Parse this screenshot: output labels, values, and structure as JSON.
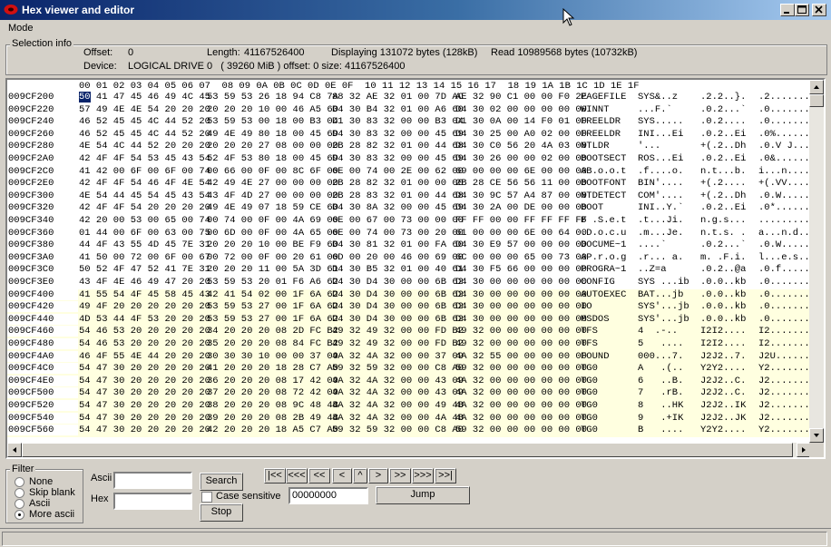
{
  "window": {
    "title": "Hex viewer and editor"
  },
  "menu": {
    "items": [
      "Mode"
    ]
  },
  "selection_info": {
    "legend": "Selection info",
    "offset_label": "Offset:",
    "offset_value": "0",
    "length_label": "Length:",
    "length_value": "41167526400",
    "displaying": "Displaying 131072 bytes (128kB)",
    "read": "Read 10989568 bytes (10732kB)",
    "device_label": "Device:",
    "device_value": "LOGICAL DRIVE 0   ( 39260 MiB ) offset: 0 size: 41167526400"
  },
  "hex_header": "00 01 02 03 04 05 06 07  08 09 0A 0B 0C 0D 0E 0F  10 11 12 13 14 15 16 17  18 19 1A 1B 1C 1D 1E 1F",
  "selected_byte": "50",
  "rows": [
    {
      "off": "009CF200",
      "h1": "50 41 47 45 46 49 4C 45",
      "h2": "53 59 53 26 18 94 C8 7A",
      "h3": "88 32 AE 32 01 00 7D AC",
      "h4": "AE 32 90 C1 00 00 F0 2E",
      "a1": "PAGEFILE",
      "a2": "SYS&..z",
      "a3": ".2.2..}.",
      "a4": ".2........",
      "hl": false
    },
    {
      "off": "009CF220",
      "h1": "57 49 4E 4E 54 20 20 20",
      "h2": "20 20 20 10 00 46 A5 60",
      "h3": "D4 30 B4 32 01 00 A6 60",
      "h4": "D4 30 02 00 00 00 00 00",
      "a1": "WINNT",
      "a2": "...F.`",
      "a3": ".0.2...`",
      "a4": ".0........",
      "hl": false
    },
    {
      "off": "009CF240",
      "h1": "46 52 45 45 4C 44 52 20",
      "h2": "53 59 53 00 18 00 B3 04",
      "h3": "D1 30 83 32 00 00 B3 04",
      "h4": "D1 30 0A 00 14 F0 01 00",
      "a1": "FREELDR",
      "a2": "SYS.....",
      "a3": ".0.2....",
      "a4": ".0........",
      "hl": false
    },
    {
      "off": "009CF260",
      "h1": "46 52 45 45 4C 44 52 20",
      "h2": "49 4E 49 80 18 00 45 69",
      "h3": "D4 30 83 32 00 00 45 69",
      "h4": "D4 30 25 00 A0 02 00 00",
      "a1": "FREELDR",
      "a2": "INI...Ei",
      "a3": ".0.2..Ei",
      "a4": ".0%.......",
      "hl": false
    },
    {
      "off": "009CF280",
      "h1": "4E 54 4C 44 52 20 20 20",
      "h2": "20 20 20 27 08 00 00 00",
      "h3": "2B 28 82 32 01 00 44 68",
      "h4": "D4 30 C0 56 20 4A 03 00",
      "a1": "NTLDR",
      "a2": "'...",
      "a3": "+(.2..Dh",
      "a4": ".0.V J....",
      "hl": false
    },
    {
      "off": "009CF2A0",
      "h1": "42 4F 4F 54 53 45 43 54",
      "h2": "52 4F 53 80 18 00 45 69",
      "h3": "D4 30 83 32 00 00 45 69",
      "h4": "D4 30 26 00 00 02 00 00",
      "a1": "BOOTSECT",
      "a2": "ROS...Ei",
      "a3": ".0.2..Ei",
      "a4": ".0&.......",
      "hl": false
    },
    {
      "off": "009CF2C0",
      "h1": "41 42 00 6F 00 6F 00 74",
      "h2": "00 66 00 0F 00 8C 6F 00",
      "h3": "6E 00 74 00 2E 00 62 00",
      "h4": "69 00 00 00 6E 00 00 00",
      "a1": "AB.o.o.t",
      "a2": ".f....o.",
      "a3": "n.t...b.",
      "a4": "i...n.....",
      "hl": false
    },
    {
      "off": "009CF2E0",
      "h1": "42 4F 4F 54 46 4F 4E 54",
      "h2": "42 49 4E 27 00 00 00 00",
      "h3": "2B 28 82 32 01 00 00 00",
      "h4": "2B 28 CE 56 56 11 00 00",
      "a1": "BOOTFONT",
      "a2": "BIN'....",
      "a3": "+(.2....",
      "a4": "+(.VV.....",
      "hl": false
    },
    {
      "off": "009CF300",
      "h1": "4E 54 44 45 54 45 43 54",
      "h2": "43 4F 4D 27 00 00 00 00",
      "h3": "2B 28 83 32 01 00 44 68",
      "h4": "D4 30 9C 57 A4 87 00 00",
      "a1": "NTDETECT",
      "a2": "COM'....",
      "a3": "+(.2..Dh",
      "a4": ".0.W......",
      "hl": false
    },
    {
      "off": "009CF320",
      "h1": "42 4F 4F 54 20 20 20 20",
      "h2": "49 4E 49 07 18 59 CE 60",
      "h3": "D4 30 8A 32 00 00 45 69",
      "h4": "D4 30 2A 00 DE 00 00 00",
      "a1": "BOOT",
      "a2": "INI..Y.`",
      "a3": ".0.2..Ei",
      "a4": ".0*.......",
      "hl": false
    },
    {
      "off": "009CF340",
      "h1": "42 20 00 53 00 65 00 74",
      "h2": "00 74 00 0F 00 4A 69 00",
      "h3": "6E 00 67 00 73 00 00 00",
      "h4": "FF FF 00 00 FF FF FF FF",
      "a1": "B .S.e.t",
      "a2": ".t...Ji.",
      "a3": "n.g.s...",
      "a4": "..........",
      "hl": false
    },
    {
      "off": "009CF360",
      "h1": "01 44 00 6F 00 63 00 75",
      "h2": "00 6D 00 0F 00 4A 65 00",
      "h3": "6E 00 74 00 73 00 20 00",
      "h4": "61 00 00 00 6E 00 64 00",
      "a1": ".D.o.c.u",
      "a2": ".m...Je.",
      "a3": "n.t.s. .",
      "a4": "a...n.d...",
      "hl": false
    },
    {
      "off": "009CF380",
      "h1": "44 4F 43 55 4D 45 7E 31",
      "h2": "20 20 20 10 00 BE F9 60",
      "h3": "D4 30 81 32 01 00 FA 60",
      "h4": "D4 30 E9 57 00 00 00 00",
      "a1": "DOCUME~1",
      "a2": "....`",
      "a3": ".0.2...`",
      "a4": ".0.W......",
      "hl": false
    },
    {
      "off": "009CF3A0",
      "h1": "41 50 00 72 00 6F 00 67",
      "h2": "00 72 00 0F 00 20 61 00",
      "h3": "6D 00 20 00 46 00 69 00",
      "h4": "6C 00 00 00 65 00 73 00",
      "a1": "AP.r.o.g",
      "a2": ".r... a.",
      "a3": "m. .F.i.",
      "a4": "l...e.s...",
      "hl": false
    },
    {
      "off": "009CF3C0",
      "h1": "50 52 4F 47 52 41 7E 31",
      "h2": "20 20 20 11 00 5A 3D 61",
      "h3": "D4 30 B5 32 01 00 40 61",
      "h4": "D4 30 F5 66 00 00 00 00",
      "a1": "PROGRA~1",
      "a2": "..Z=a",
      "a3": ".0.2..@a",
      "a4": ".0.f......",
      "hl": false
    },
    {
      "off": "009CF3E0",
      "h1": "43 4F 4E 46 49 47 20 20",
      "h2": "53 59 53 20 01 F6 A6 62",
      "h3": "D4 30 D4 30 00 00 6B 62",
      "h4": "D4 30 00 00 00 00 00 00",
      "a1": "CONFIG",
      "a2": "SYS ...ib",
      "a3": ".0.0..kb",
      "a4": ".0........",
      "hl": false
    },
    {
      "off": "009CF400",
      "h1": "41 55 54 4F 45 58 45 43",
      "h2": "42 41 54 02 00 1F 6A 62",
      "h3": "D4 30 D4 30 00 00 6B 62",
      "h4": "D4 30 00 00 00 00 00 00",
      "a1": "AUTOEXEC",
      "a2": "BAT...jb",
      "a3": ".0.0..kb",
      "a4": ".0........",
      "hl": true
    },
    {
      "off": "009CF420",
      "h1": "49 4F 20 20 20 20 20 20",
      "h2": "53 59 53 27 00 1F 6A 62",
      "h3": "D4 30 D4 30 00 00 6B 62",
      "h4": "D4 30 00 00 00 00 00 00",
      "a1": "IO",
      "a2": "SYS'...jb",
      "a3": ".0.0..kb",
      "a4": ".0........",
      "hl": true
    },
    {
      "off": "009CF440",
      "h1": "4D 53 44 4F 53 20 20 20",
      "h2": "53 59 53 27 00 1F 6A 62",
      "h3": "D4 30 D4 30 00 00 6B 62",
      "h4": "D4 30 00 00 00 00 00 00",
      "a1": "MSDOS",
      "a2": "SYS'...jb",
      "a3": ".0.0..kb",
      "a4": ".0........",
      "hl": true
    },
    {
      "off": "009CF460",
      "h1": "54 46 53 20 20 20 20 20",
      "h2": "34 20 20 20 08 2D FC B2",
      "h3": "49 32 49 32 00 00 FD B2",
      "h4": "49 32 00 00 00 00 00 00",
      "a1": "TFS",
      "a2": "4  .-..",
      "a3": "I2I2....",
      "a4": "I2........",
      "hl": true
    },
    {
      "off": "009CF480",
      "h1": "54 46 53 20 20 20 20 20",
      "h2": "35 20 20 20 08 84 FC B2",
      "h3": "49 32 49 32 00 00 FD B2",
      "h4": "49 32 00 00 00 00 00 00",
      "a1": "TFS",
      "a2": "5   ....",
      "a3": "I2I2....",
      "a4": "I2........",
      "hl": true
    },
    {
      "off": "009CF4A0",
      "h1": "46 4F 55 4E 44 20 20 20",
      "h2": "30 30 30 10 00 00 37 09",
      "h3": "4A 32 4A 32 00 00 37 09",
      "h4": "4A 32 55 00 00 00 00 00",
      "a1": "FOUND",
      "a2": "000...7.",
      "a3": "J2J2..7.",
      "a4": "J2U.......",
      "hl": true
    },
    {
      "off": "009CF4C0",
      "h1": "54 47 30 20 20 20 20 20",
      "h2": "41 20 20 20 18 28 C7 A0",
      "h3": "59 32 59 32 00 00 C8 A0",
      "h4": "59 32 00 00 00 00 00 00",
      "a1": "TG0",
      "a2": "A   .(..",
      "a3": "Y2Y2....",
      "a4": "Y2........",
      "hl": true
    },
    {
      "off": "009CF4E0",
      "h1": "54 47 30 20 20 20 20 20",
      "h2": "36 20 20 20 08 17 42 09",
      "h3": "4A 32 4A 32 00 00 43 09",
      "h4": "4A 32 00 00 00 00 00 00",
      "a1": "TG0",
      "a2": "6   ..B.",
      "a3": "J2J2..C.",
      "a4": "J2........",
      "hl": true
    },
    {
      "off": "009CF500",
      "h1": "54 47 30 20 20 20 20 20",
      "h2": "37 20 20 20 08 72 42 09",
      "h3": "4A 32 4A 32 00 00 43 09",
      "h4": "4A 32 00 00 00 00 00 00",
      "a1": "TG0",
      "a2": "7   .rB.",
      "a3": "J2J2..C.",
      "a4": "J2........",
      "hl": true
    },
    {
      "off": "009CF520",
      "h1": "54 47 30 20 20 20 20 20",
      "h2": "38 20 20 20 08 9C 48 4B",
      "h3": "4A 32 4A 32 00 00 49 4B",
      "h4": "4A 32 00 00 00 00 00 00",
      "a1": "TG0",
      "a2": "8   ..HK",
      "a3": "J2J2..IK",
      "a4": "J2........",
      "hl": true
    },
    {
      "off": "009CF540",
      "h1": "54 47 30 20 20 20 20 20",
      "h2": "39 20 20 20 08 2B 49 4B",
      "h3": "4A 32 4A 32 00 00 4A 4B",
      "h4": "4A 32 00 00 00 00 00 00",
      "a1": "TG0",
      "a2": "9   .+IK",
      "a3": "J2J2..JK",
      "a4": "J2........",
      "hl": true
    },
    {
      "off": "009CF560",
      "h1": "54 47 30 20 20 20 20 20",
      "h2": "42 20 20 20 18 A5 C7 A0",
      "h3": "59 32 59 32 00 00 C8 A0",
      "h4": "59 32 00 00 00 00 00 00",
      "a1": "TG0",
      "a2": "B   ....",
      "a3": "Y2Y2....",
      "a4": "Y2........",
      "hl": true
    }
  ],
  "filter": {
    "legend": "Filter",
    "options": [
      {
        "label": "None",
        "checked": false
      },
      {
        "label": "Skip blank",
        "checked": false
      },
      {
        "label": "Ascii",
        "checked": false
      },
      {
        "label": "More ascii",
        "checked": true
      }
    ]
  },
  "search": {
    "ascii_label": "Ascii",
    "ascii_value": "",
    "hex_label": "Hex",
    "hex_value": "",
    "search_button": "Search",
    "case_sensitive_label": "Case sensitive",
    "stop_button": "Stop"
  },
  "nav": {
    "buttons": [
      "|<<",
      "<<<",
      "<<",
      "<",
      "^",
      ">",
      ">>",
      ">>>",
      ">>|"
    ],
    "offset_value": "00000000",
    "jump_button": "Jump"
  },
  "colors": {
    "titlebar_start": "#0a246a",
    "titlebar_end": "#a6caf0",
    "highlight_row": "#ffffe0",
    "face": "#d4d0c8"
  }
}
